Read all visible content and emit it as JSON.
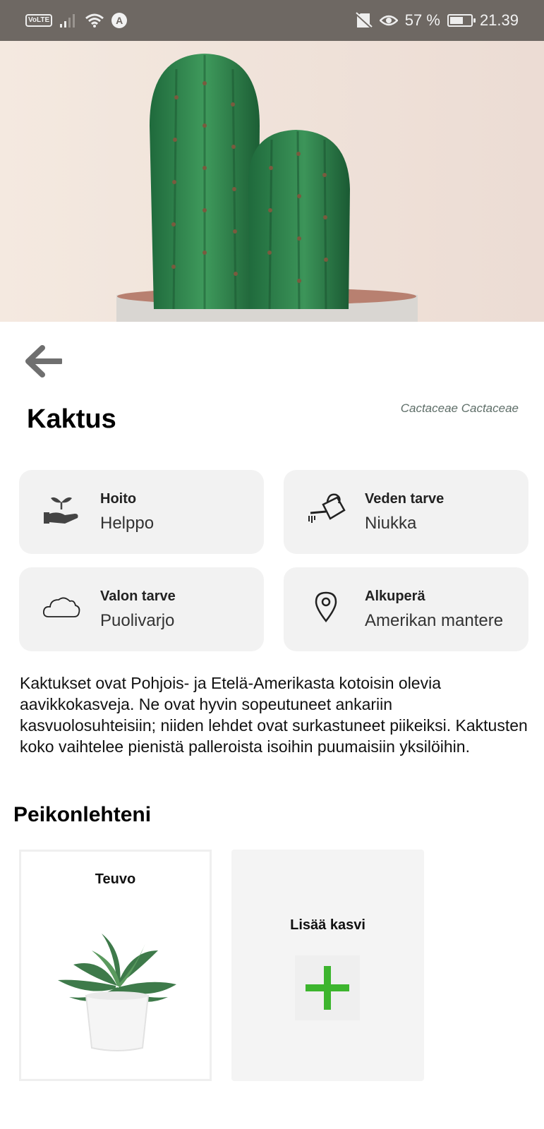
{
  "status_bar": {
    "volte": "VoLTE",
    "nav_badge": "A",
    "battery_percent": "57 %",
    "time": "21.39"
  },
  "plant": {
    "name": "Kaktus",
    "scientific_name": "Cactaceae Cactaceae"
  },
  "info": [
    {
      "icon": "hand-plant-icon",
      "label": "Hoito",
      "value": "Helppo"
    },
    {
      "icon": "watering-can-icon",
      "label": "Veden tarve",
      "value": "Niukka"
    },
    {
      "icon": "cloud-icon",
      "label": "Valon tarve",
      "value": "Puolivarjo"
    },
    {
      "icon": "location-pin-icon",
      "label": "Alkuperä",
      "value": "Amerikan mantere"
    }
  ],
  "description": "Kaktukset ovat Pohjois- ja Etelä-Amerikasta kotoisin olevia aavikkokasveja. Ne ovat hyvin sopeutuneet ankariin kasvuolosuhteisiin; niiden lehdet ovat surkastuneet piikeiksi. Kaktusten koko vaihtelee pienistä palleroista isoihin puumaisiin yksilöihin.",
  "my_plants": {
    "title": "Peikonlehteni",
    "items": [
      {
        "name": "Teuvo"
      }
    ],
    "add_label": "Lisää kasvi"
  },
  "colors": {
    "status_bar": "#6e6863",
    "card_bg": "#f2f2f2",
    "accent_plus": "#3db52e"
  }
}
